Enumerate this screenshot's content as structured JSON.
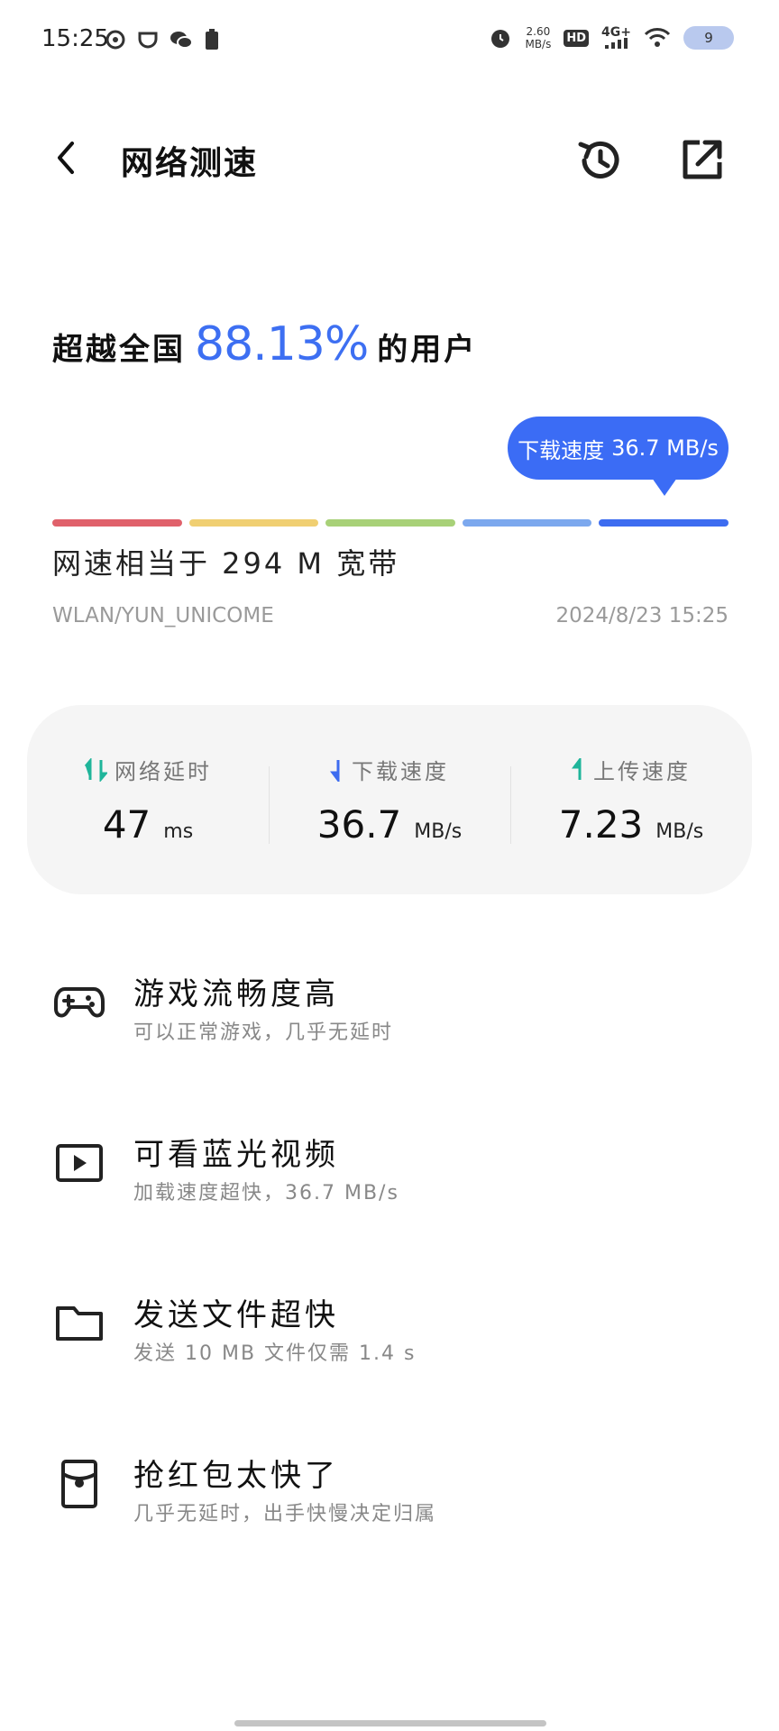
{
  "status_bar": {
    "time": "15:25",
    "left_icons": [
      "netease-music-icon",
      "cup-icon",
      "wechat-icon",
      "sim-battery-icon"
    ],
    "alarm_icon": "alarm-icon",
    "net_speed_value": "2.60",
    "net_speed_unit": "MB/s",
    "hd_label": "HD",
    "network_type": "4G+",
    "battery_level": "9"
  },
  "app_bar": {
    "title": "网络测速",
    "back_icon": "back-arrow-icon",
    "history_icon": "history-icon",
    "share_icon": "share-icon"
  },
  "result": {
    "headline_prefix": "超越全国",
    "percent": "88.13%",
    "headline_suffix": "的用户",
    "tooltip_label": "下载速度",
    "tooltip_value": "36.7 MB/s",
    "equivalent": "网速相当于 294 M 宽带",
    "network_name": "WLAN/YUN_UNICOME",
    "timestamp": "2024/8/23 15:25",
    "level_colors": [
      "#e0616b",
      "#f0cf72",
      "#a8d178",
      "#7ca8ee",
      "#3d6cf0"
    ],
    "level_active_index": 4
  },
  "metrics": [
    {
      "label": "网络延时",
      "value": "47",
      "unit": "ms",
      "icon": "latency-arrows-icon",
      "color": "#1fb59a"
    },
    {
      "label": "下载速度",
      "value": "36.7",
      "unit": "MB/s",
      "icon": "download-arrow-icon",
      "color": "#3d6cf0"
    },
    {
      "label": "上传速度",
      "value": "7.23",
      "unit": "MB/s",
      "icon": "upload-arrow-icon",
      "color": "#1fb59a"
    }
  ],
  "features": [
    {
      "title": "游戏流畅度高",
      "subtitle": "可以正常游戏，几乎无延时",
      "icon": "gamepad-icon"
    },
    {
      "title": "可看蓝光视频",
      "subtitle": "加载速度超快，36.7 MB/s",
      "icon": "video-play-icon"
    },
    {
      "title": "发送文件超快",
      "subtitle": "发送 10 MB 文件仅需 1.4 s",
      "icon": "folder-icon"
    },
    {
      "title": "抢红包太快了",
      "subtitle": "几乎无延时，出手快慢决定归属",
      "icon": "red-packet-icon"
    }
  ]
}
